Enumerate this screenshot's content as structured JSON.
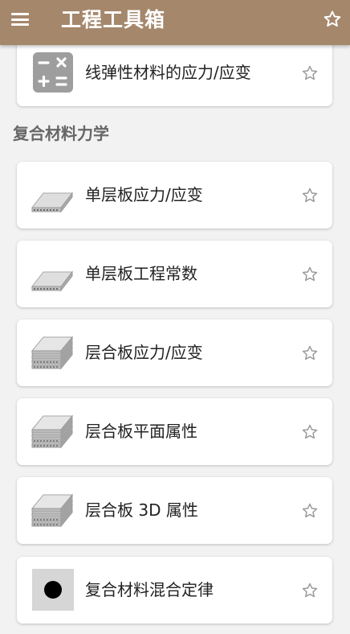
{
  "appbar": {
    "title": "工程工具箱",
    "menu_icon": "hamburger-menu-icon",
    "favorites_icon": "star-outline-icon",
    "background": "#a5876c"
  },
  "top_item": {
    "label": "线弹性材料的应力/应变",
    "icon": "calculator-icon",
    "star_icon": "star-outline-icon"
  },
  "section": {
    "title": "复合材料力学"
  },
  "items": [
    {
      "label": "单层板应力/应变",
      "icon": "single-ply-icon",
      "star_icon": "star-outline-icon"
    },
    {
      "label": "单层板工程常数",
      "icon": "single-ply-icon",
      "star_icon": "star-outline-icon"
    },
    {
      "label": "层合板应力/应变",
      "icon": "laminate-icon",
      "star_icon": "star-outline-icon"
    },
    {
      "label": "层合板平面属性",
      "icon": "laminate-icon",
      "star_icon": "star-outline-icon"
    },
    {
      "label": "层合板 3D 属性",
      "icon": "laminate-icon",
      "star_icon": "star-outline-icon"
    },
    {
      "label": "复合材料混合定律",
      "icon": "rule-of-mixtures-icon",
      "star_icon": "star-outline-icon"
    }
  ]
}
